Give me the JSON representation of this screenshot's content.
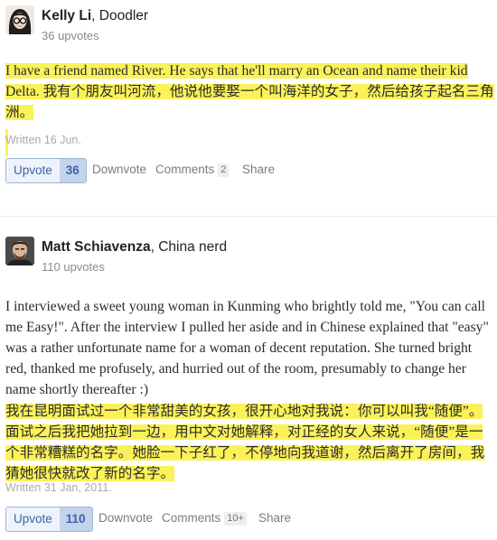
{
  "answers": [
    {
      "author": {
        "name": "Kelly Li",
        "credential": "Doodler",
        "upvotes_text": "36 upvotes",
        "avatar_icon": "avatar-woman-glasses-icon"
      },
      "paragraphs": [
        {
          "text": "I have a friend named River. He says that he'll marry an Ocean and name their kid Delta. 我有个朋友叫河流，他说他要娶一个叫海洋的女子，然后给孩子起名三角洲。",
          "highlight": true
        }
      ],
      "written": "Written 16 Jun.",
      "actions": {
        "upvote_label": "Upvote",
        "upvote_count": "36",
        "downvote": "Downvote",
        "comments": "Comments",
        "comments_count": "2",
        "share": "Share"
      }
    },
    {
      "author": {
        "name": "Matt Schiavenza",
        "credential": "China nerd",
        "upvotes_text": "110 upvotes",
        "avatar_icon": "avatar-man-icon"
      },
      "paragraphs": [
        {
          "text": "I interviewed a sweet young woman in Kunming who brightly told me, \"You can call me Easy!\". After the interview I pulled her aside and in Chinese explained that \"easy\" was a rather unfortunate name for a woman of decent reputation. She turned bright red, thanked me profusely, and hurried out of the room, presumably to change her name shortly thereafter :)",
          "highlight": false
        },
        {
          "text": "我在昆明面试过一个非常甜美的女孩，很开心地对我说：你可以叫我“随便”。面试之后我把她拉到一边，用中文对她解释，对正经的女人来说，“随便”是一个非常糟糕的名字。她脸一下子红了，不停地向我道谢，然后离开了房间，我猜她很快就改了新的名字。",
          "highlight": true
        }
      ],
      "written": "Written 31 Jan, 2011.",
      "actions": {
        "upvote_label": "Upvote",
        "upvote_count": "110",
        "downvote": "Downvote",
        "comments": "Comments",
        "comments_count": "10+",
        "share": "Share"
      }
    }
  ],
  "colors": {
    "highlight": "#fbf25a",
    "upvote_text": "#3b63a7",
    "upvote_bg": "#eef3fb",
    "upvote_count_bg": "#c4d3ec",
    "meta_gray": "#8a8a8a"
  }
}
